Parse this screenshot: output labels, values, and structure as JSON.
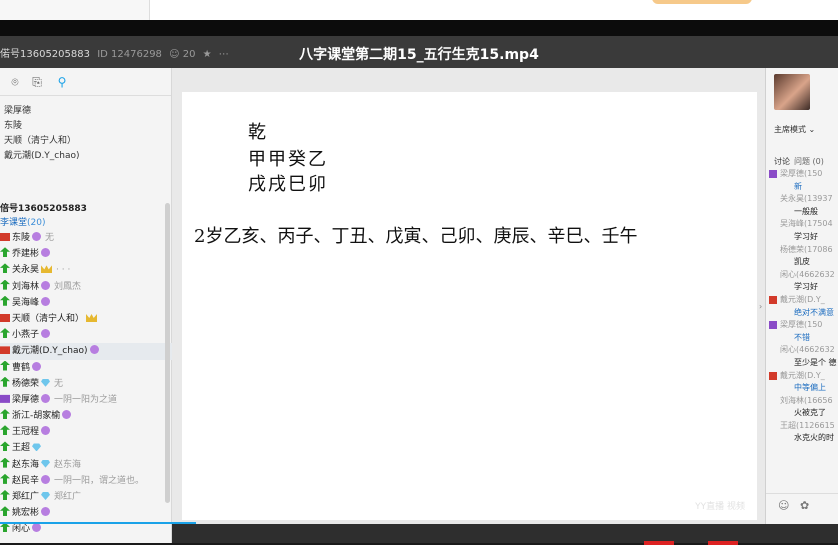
{
  "window": {
    "room_label": "偌号13605205883",
    "room_id": "ID 12476298",
    "fans": "☺ 20",
    "video_title": "八字课堂第二期15_五行生克15.mp4"
  },
  "left": {
    "toolbar_icons": [
      "location-icon",
      "share-icon",
      "search-icon"
    ],
    "admins": [
      "梁厚德",
      "东陵",
      "天顺（清宁人和）",
      "戴元潮(D.Y_chao)"
    ],
    "owner": "倍号13605205883",
    "group_name": "李课堂",
    "group_count": "(20)",
    "members": [
      {
        "badge": "red",
        "name": "东陵",
        "lv": true,
        "note": "无"
      },
      {
        "badge": "green",
        "name": "乔建彬",
        "lv": true,
        "note": ""
      },
      {
        "badge": "green",
        "name": "关永昊",
        "crown": true,
        "note": "· · ·"
      },
      {
        "badge": "green",
        "name": "刘海林",
        "lv": true,
        "note": "刘鳳杰"
      },
      {
        "badge": "green",
        "name": "吴海峰",
        "lv": true,
        "note": ""
      },
      {
        "badge": "red",
        "name": "天顺（清宁人和）",
        "crown": true,
        "note": ""
      },
      {
        "badge": "green",
        "name": "小燕子",
        "lv": true,
        "note": ""
      },
      {
        "badge": "red",
        "name": "戴元潮(D.Y_chao)",
        "lv": true,
        "note": "",
        "selected": true
      },
      {
        "badge": "green",
        "name": "曹鹤",
        "lv": true,
        "note": ""
      },
      {
        "badge": "green",
        "name": "杨德荣",
        "gem": true,
        "note": "无"
      },
      {
        "badge": "purple",
        "name": "梁厚德",
        "lv": true,
        "note": "一阴一阳为之道"
      },
      {
        "badge": "green",
        "name": "浙江-胡家榆",
        "lv": true,
        "note": ""
      },
      {
        "badge": "green",
        "name": "王冠程",
        "lv": true,
        "note": ""
      },
      {
        "badge": "green",
        "name": "王超",
        "gem": true,
        "note": ""
      },
      {
        "badge": "green",
        "name": "赵东海",
        "gem": true,
        "note": "赵东海"
      },
      {
        "badge": "green",
        "name": "赵民辛",
        "lv": true,
        "note": "一阴一阳，谓之道也。"
      },
      {
        "badge": "green",
        "name": "郑红广",
        "gem": true,
        "note": "郑红广"
      },
      {
        "badge": "green",
        "name": "姚宏彬",
        "lv": true,
        "note": ""
      },
      {
        "badge": "green",
        "name": "闲心",
        "lv": true,
        "note": ""
      }
    ]
  },
  "whiteboard": {
    "label": "乾",
    "stems": "甲甲癸乙",
    "branches": "戌戌巳卯",
    "luck_prefix": "2岁",
    "luck_pillars": "乙亥、丙子、丁丑、戊寅、己卯、庚辰、辛巳、壬午",
    "watermark": "YY直播 视频"
  },
  "right": {
    "mode_label": "主席模式 ⌄",
    "tab_discuss": "讨论",
    "tab_question": "问题 (0)",
    "chat": [
      {
        "type": "name",
        "flag": "fp",
        "text": "梁厚德(150"
      },
      {
        "type": "msg",
        "blue": true,
        "text": "新"
      },
      {
        "type": "name",
        "flag": "",
        "text": "关永昊(13937"
      },
      {
        "type": "msg",
        "blue": false,
        "text": "一般般"
      },
      {
        "type": "name",
        "flag": "",
        "text": "吴海峰(17504"
      },
      {
        "type": "msg",
        "blue": false,
        "text": "学习好"
      },
      {
        "type": "name",
        "flag": "",
        "text": "杨德荣(17086"
      },
      {
        "type": "msg",
        "blue": false,
        "text": "凯皮"
      },
      {
        "type": "name",
        "flag": "",
        "text": "闲心(4662632"
      },
      {
        "type": "msg",
        "blue": false,
        "text": "学习好"
      },
      {
        "type": "name",
        "flag": "fr",
        "text": "戴元潮(D.Y_"
      },
      {
        "type": "msg",
        "blue": true,
        "text": "绝对不满意"
      },
      {
        "type": "name",
        "flag": "fp",
        "text": "梁厚德(150"
      },
      {
        "type": "msg",
        "blue": true,
        "text": "不错"
      },
      {
        "type": "name",
        "flag": "",
        "text": "闲心(4662632"
      },
      {
        "type": "msg",
        "blue": false,
        "text": "至少是个 德"
      },
      {
        "type": "name",
        "flag": "fr",
        "text": "戴元潮(D.Y_"
      },
      {
        "type": "msg",
        "blue": true,
        "text": "中等偏上"
      },
      {
        "type": "name",
        "flag": "",
        "text": "刘海林(16656"
      },
      {
        "type": "msg",
        "blue": false,
        "text": "火被克了"
      },
      {
        "type": "name",
        "flag": "",
        "text": "王超(1126615"
      },
      {
        "type": "msg",
        "blue": false,
        "text": "水克火的时"
      }
    ],
    "bottom_icons": [
      "smile-icon",
      "flower-icon"
    ]
  }
}
